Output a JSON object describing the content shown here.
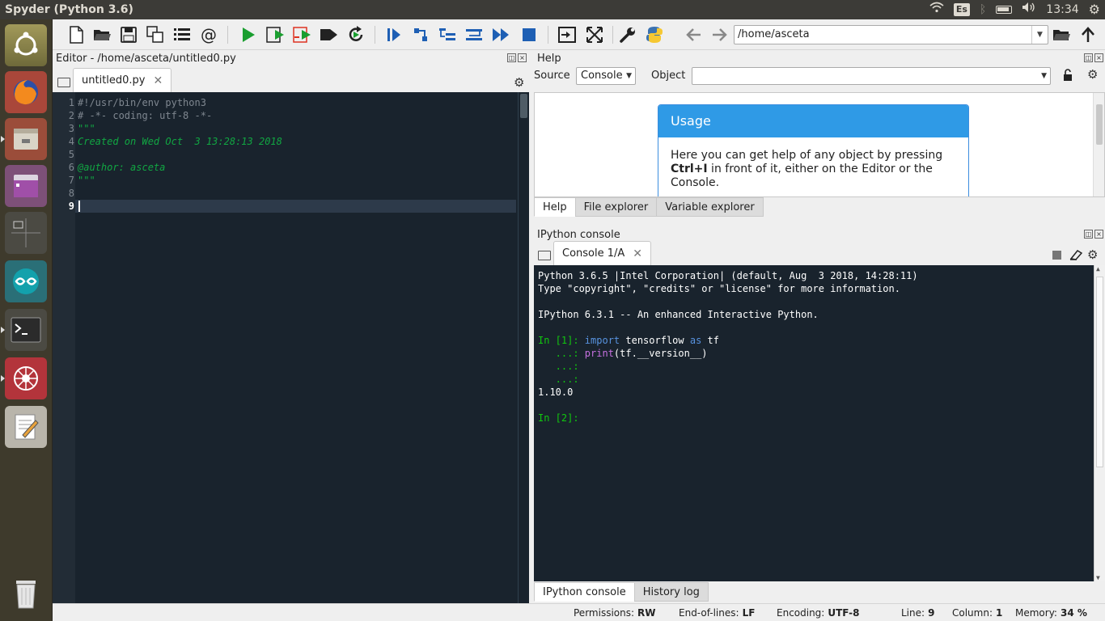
{
  "window": {
    "title": "Spyder (Python 3.6)"
  },
  "topbar": {
    "keyboard_layout": "Es",
    "clock": "13:34"
  },
  "toolbar": {
    "working_directory": "/home/asceta"
  },
  "editor": {
    "title": "Editor - /home/asceta/untitled0.py",
    "tab_label": "untitled0.py",
    "lines": [
      {
        "num": "1",
        "text": "#!/usr/bin/env python3"
      },
      {
        "num": "2",
        "text": "# -*- coding: utf-8 -*-"
      },
      {
        "num": "3",
        "text": "\"\"\""
      },
      {
        "num": "4",
        "text": "Created on Wed Oct  3 13:28:13 2018"
      },
      {
        "num": "5",
        "text": ""
      },
      {
        "num": "6",
        "text": "@author: asceta"
      },
      {
        "num": "7",
        "text": "\"\"\""
      },
      {
        "num": "8",
        "text": ""
      },
      {
        "num": "9",
        "text": ""
      }
    ]
  },
  "help": {
    "title": "Help",
    "source_label": "Source",
    "source_value": "Console",
    "object_label": "Object",
    "object_value": "",
    "usage_heading": "Usage",
    "usage_text_1": "Here you can get help of any object by pressing",
    "usage_shortcut": "Ctrl+I",
    "usage_text_2": " in front of it, either on the Editor or the Console.",
    "tabs": [
      "Help",
      "File explorer",
      "Variable explorer"
    ]
  },
  "console": {
    "title": "IPython console",
    "tab_label": "Console 1/A",
    "banner_1": "Python 3.6.5 |Intel Corporation| (default, Aug  3 2018, 14:28:11)",
    "banner_2": "Type \"copyright\", \"credits\" or \"license\" for more information.",
    "banner_3": "IPython 6.3.1 -- An enhanced Interactive Python.",
    "in1_prompt": "In [1]: ",
    "in1_kw1": "import",
    "in1_mid": " tensorflow ",
    "in1_kw2": "as",
    "in1_end": " tf",
    "cont_prompt": "   ...: ",
    "line2_fn": "print",
    "line2_rest": "(tf.__version__)",
    "cont_empty": "   ...:",
    "output": "1.10.0",
    "in2_prompt": "In [2]:",
    "tabs": [
      "IPython console",
      "History log"
    ]
  },
  "statusbar": {
    "permissions_label": "Permissions:",
    "permissions_value": "RW",
    "eol_label": "End-of-lines:",
    "eol_value": "LF",
    "encoding_label": "Encoding:",
    "encoding_value": "UTF-8",
    "line_label": "Line:",
    "line_value": "9",
    "column_label": "Column:",
    "column_value": "1",
    "memory_label": "Memory:",
    "memory_value": "34 %"
  }
}
